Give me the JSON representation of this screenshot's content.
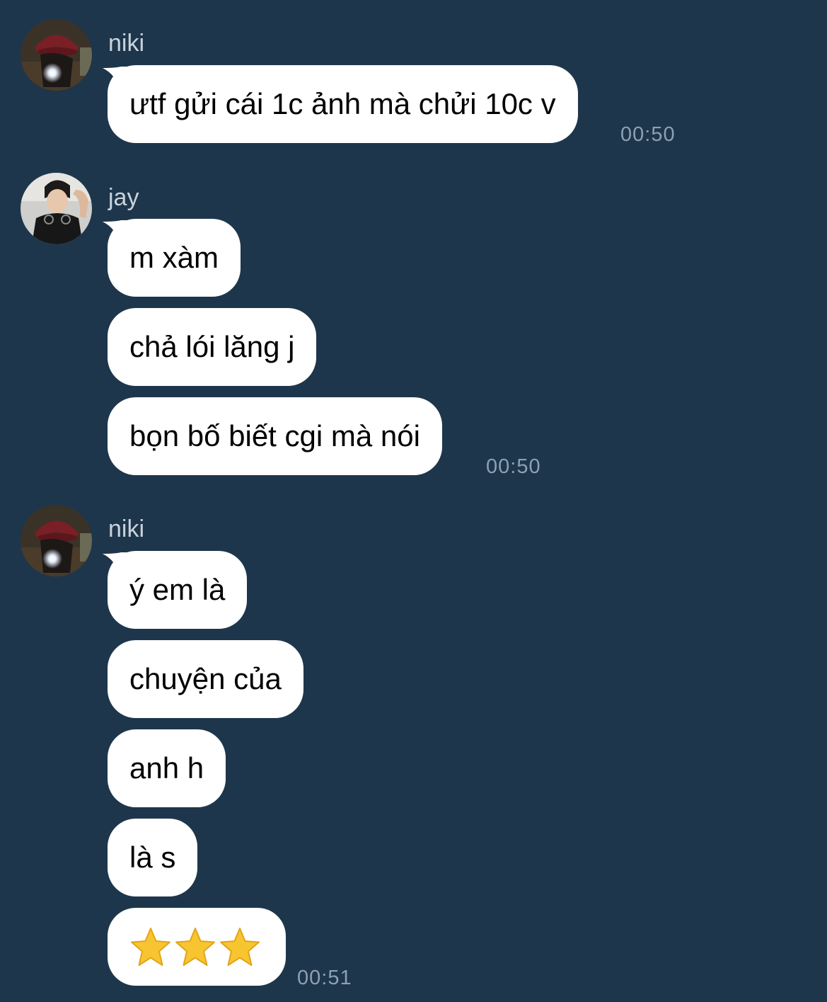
{
  "groups": [
    {
      "sender": "niki",
      "avatar_icon": "niki-avatar-photo",
      "messages": [
        {
          "text": "ưtf gửi cái 1c ảnh mà chửi 10c v"
        }
      ],
      "time": "00:50"
    },
    {
      "sender": "jay",
      "avatar_icon": "jay-avatar-photo",
      "messages": [
        {
          "text": "m xàm"
        },
        {
          "text": "chả lói lăng j"
        },
        {
          "text": "bọn bố biết cgi mà nói"
        }
      ],
      "time": "00:50"
    },
    {
      "sender": "niki",
      "avatar_icon": "niki-avatar-photo",
      "messages": [
        {
          "text": "ý em là"
        },
        {
          "text": "chuyện của"
        },
        {
          "text": "anh h"
        },
        {
          "text": "là s"
        },
        {
          "emoji": "⭐⭐⭐",
          "icon": "star-emoji"
        }
      ],
      "time": "00:51"
    }
  ],
  "colors": {
    "background": "#1e364b",
    "bubble": "#ffffff",
    "sender_name": "#c9d2dc",
    "timestamp": "#8ea0b2",
    "star": "#f7c52f"
  }
}
